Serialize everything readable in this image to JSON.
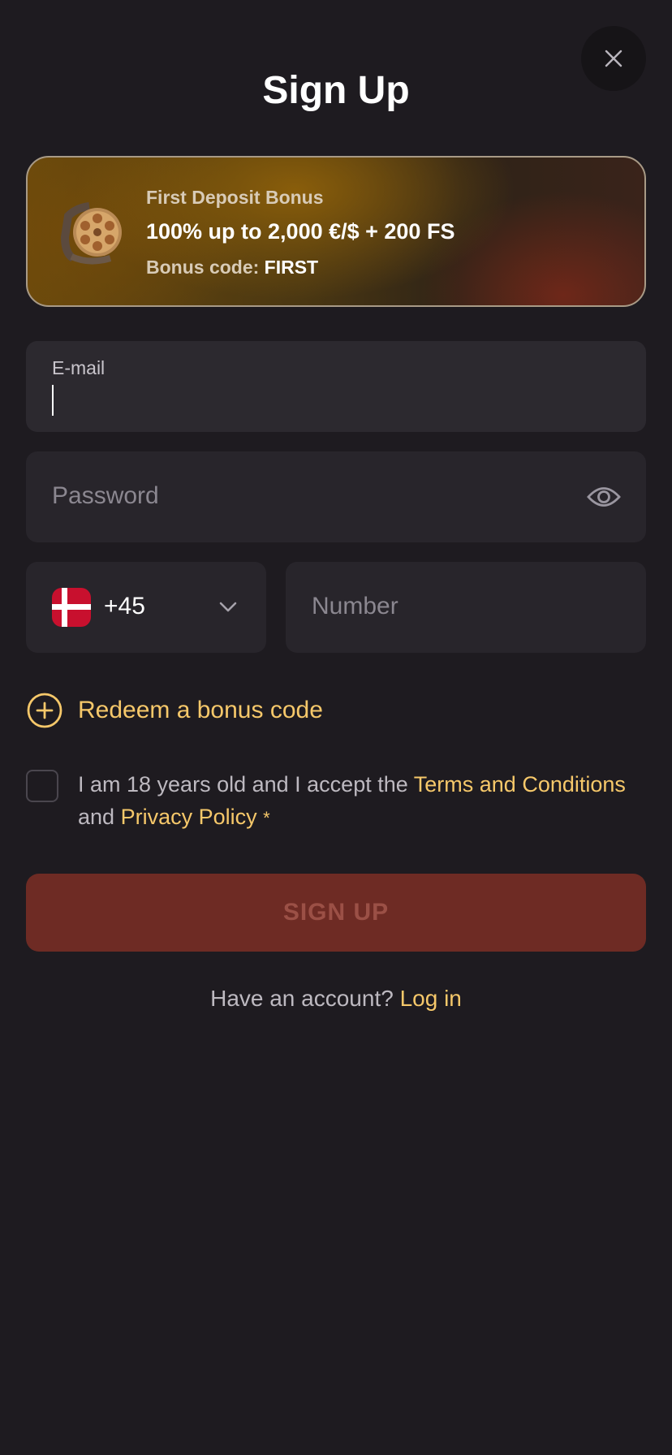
{
  "header": {
    "title": "Sign Up",
    "close_icon": "close-icon"
  },
  "bonus": {
    "label": "First Deposit Bonus",
    "amount": "100% up to 2,000 €/$ + 200 FS",
    "code_prefix": "Bonus code:",
    "code": "FIRST",
    "icon": "film-reel-icon"
  },
  "form": {
    "email": {
      "label": "E-mail",
      "value": ""
    },
    "password": {
      "placeholder": "Password",
      "toggle_icon": "eye-icon"
    },
    "phone": {
      "country_flag": "denmark-flag",
      "dial_code": "+45",
      "placeholder": "Number"
    },
    "redeem": {
      "label": "Redeem a bonus code",
      "icon": "plus-circle-icon"
    },
    "terms": {
      "text_before": "I am 18 years old and I accept the",
      "terms_link": "Terms and Conditions",
      "text_and": "and",
      "privacy_link": "Privacy Policy",
      "required_mark": "*",
      "checked": false
    },
    "submit_label": "SIGN UP"
  },
  "footer": {
    "prompt": "Have an account?",
    "login_label": "Log in"
  },
  "colors": {
    "background": "#1e1b20",
    "accent": "#f6c86a",
    "submit_disabled": "#6e2b24"
  }
}
